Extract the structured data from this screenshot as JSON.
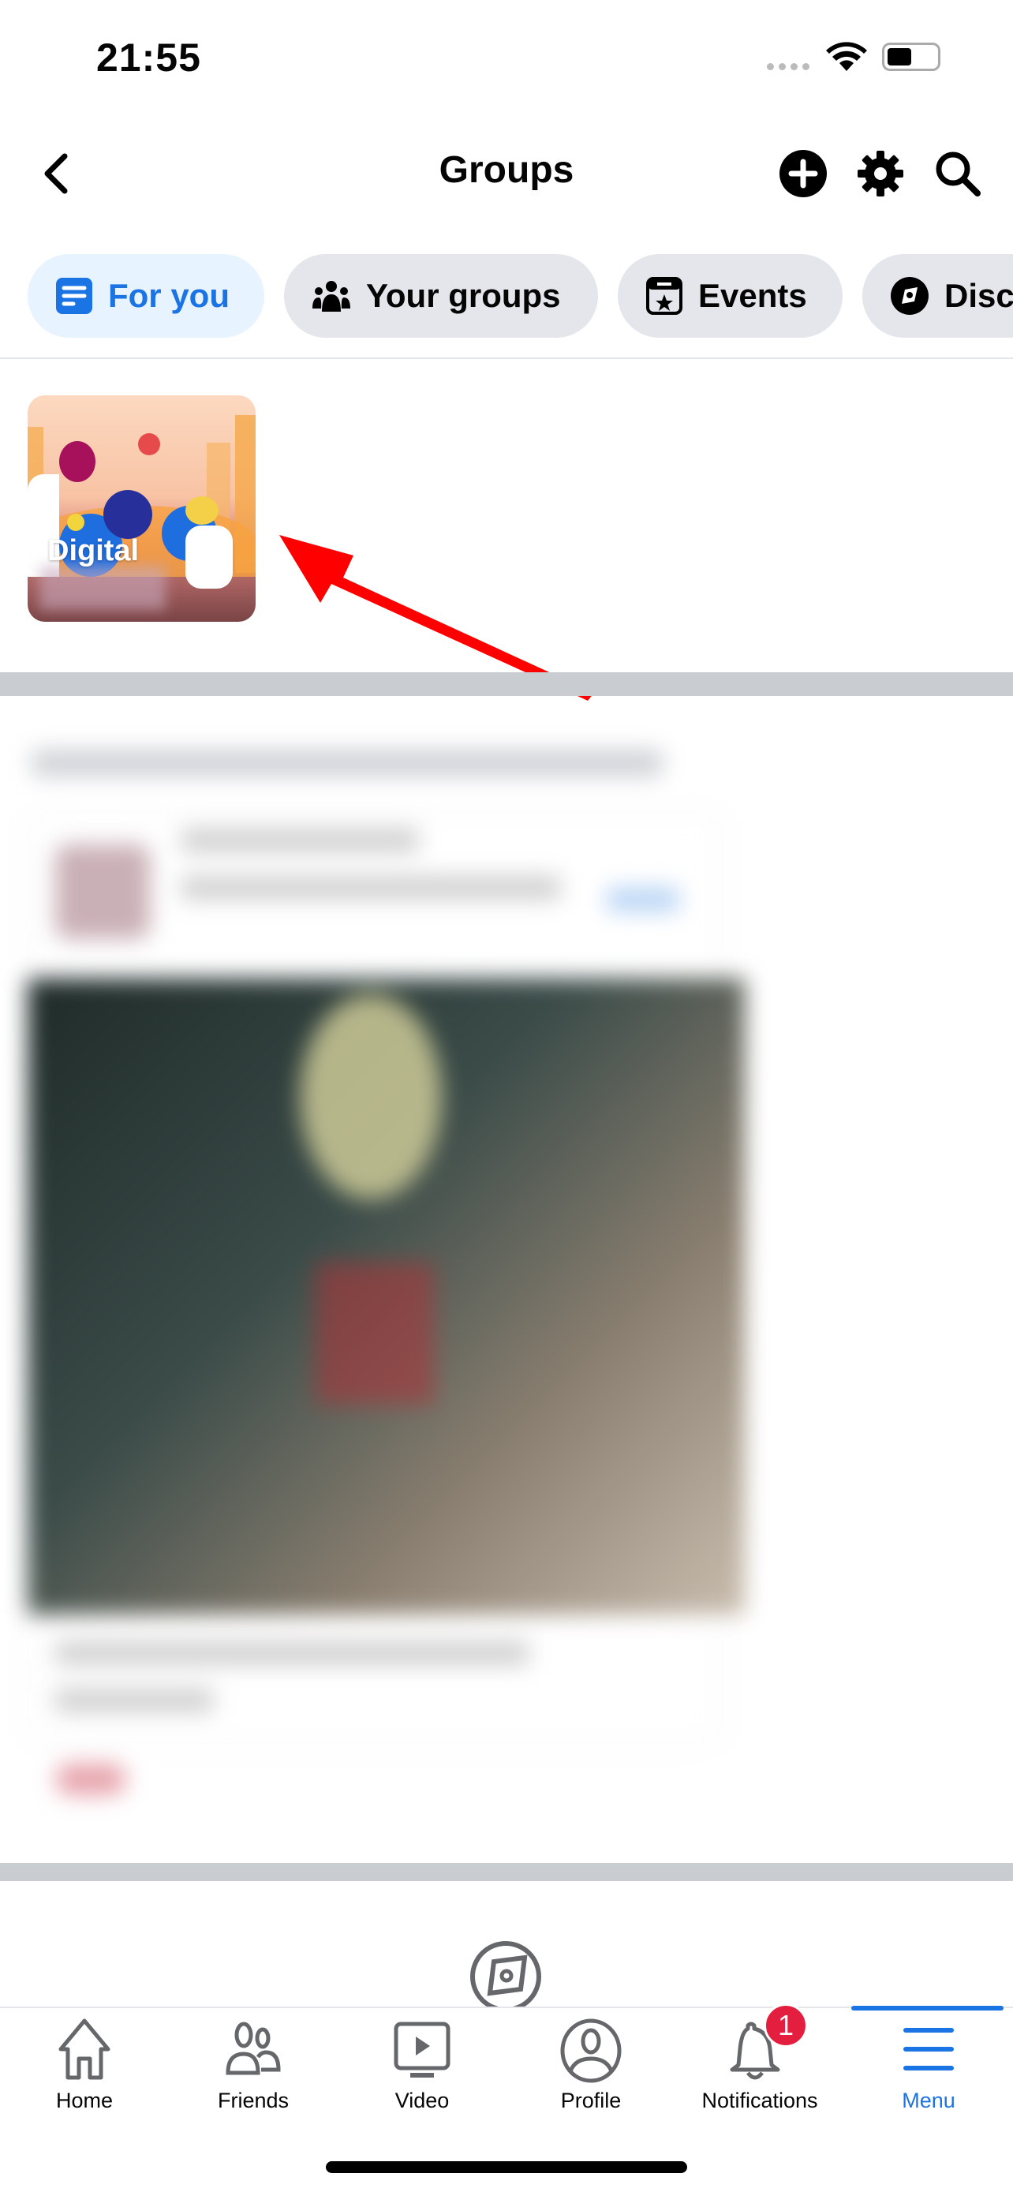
{
  "status_bar": {
    "time": "21:55"
  },
  "header": {
    "title": "Groups",
    "back_icon": "chevron-left-icon",
    "actions": [
      "plus-circle-icon",
      "gear-icon",
      "search-icon"
    ]
  },
  "chips": [
    {
      "label": "For you",
      "icon": "feed-icon",
      "active": true
    },
    {
      "label": "Your groups",
      "icon": "people-icon",
      "active": false
    },
    {
      "label": "Events",
      "icon": "calendar-star-icon",
      "active": false
    },
    {
      "label": "Disc",
      "icon": "compass-icon",
      "active": false
    }
  ],
  "group_card": {
    "label": "Digital"
  },
  "tab_bar": {
    "items": [
      {
        "label": "Home",
        "icon": "home-icon"
      },
      {
        "label": "Friends",
        "icon": "friends-icon"
      },
      {
        "label": "Video",
        "icon": "video-icon"
      },
      {
        "label": "Profile",
        "icon": "profile-icon"
      },
      {
        "label": "Notifications",
        "icon": "bell-icon",
        "badge": "1"
      },
      {
        "label": "Menu",
        "icon": "menu-icon",
        "active": true
      }
    ]
  },
  "colors": {
    "accent": "#1b74e4",
    "badge": "#e41e3f",
    "annotation_arrow": "#ff0000"
  }
}
